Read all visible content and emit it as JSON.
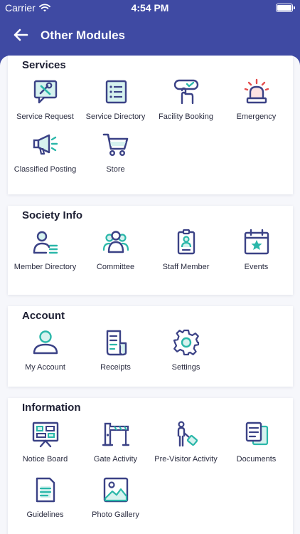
{
  "status_bar": {
    "carrier": "Carrier",
    "time": "4:54 PM"
  },
  "header": {
    "title": "Other Modules"
  },
  "colors": {
    "primary": "#3f4aa3",
    "icon_stroke": "#3b4286",
    "icon_accent": "#2ab7a9",
    "alert": "#e44d4d"
  },
  "sections": [
    {
      "title": "Services",
      "items": [
        {
          "label": "Service Request",
          "icon": "service-request-icon"
        },
        {
          "label": "Service Directory",
          "icon": "service-directory-icon"
        },
        {
          "label": "Facility Booking",
          "icon": "facility-booking-icon"
        },
        {
          "label": "Emergency",
          "icon": "emergency-siren-icon"
        },
        {
          "label": "Classified Posting",
          "icon": "megaphone-icon"
        },
        {
          "label": "Store",
          "icon": "shopping-cart-icon"
        }
      ]
    },
    {
      "title": "Society Info",
      "items": [
        {
          "label": "Member Directory",
          "icon": "member-directory-icon"
        },
        {
          "label": "Committee",
          "icon": "committee-icon"
        },
        {
          "label": "Staff Member",
          "icon": "staff-badge-icon"
        },
        {
          "label": "Events",
          "icon": "calendar-star-icon"
        }
      ]
    },
    {
      "title": "Account",
      "items": [
        {
          "label": "My Account",
          "icon": "user-icon"
        },
        {
          "label": "Receipts",
          "icon": "receipt-icon"
        },
        {
          "label": "Settings",
          "icon": "gear-icon"
        }
      ]
    },
    {
      "title": "Information",
      "items": [
        {
          "label": "Notice Board",
          "icon": "notice-board-icon"
        },
        {
          "label": "Gate Activity",
          "icon": "gate-barrier-icon"
        },
        {
          "label": "Pre-Visitor Activity",
          "icon": "visitor-luggage-icon"
        },
        {
          "label": "Documents",
          "icon": "documents-icon"
        },
        {
          "label": "Guidelines",
          "icon": "guidelines-icon"
        },
        {
          "label": "Photo Gallery",
          "icon": "photo-gallery-icon"
        }
      ]
    }
  ]
}
